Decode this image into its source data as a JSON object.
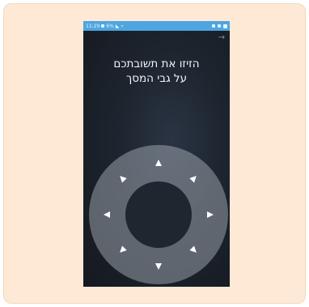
{
  "card": {
    "background": "#fde9d5",
    "border": "#f1d9bc"
  },
  "status_bar": {
    "time": "11:29",
    "battery": "6%",
    "background": "#4da6e0",
    "left_icons": [
      "battery-icon",
      "signal-icon",
      "wifi-icon"
    ],
    "right_icons": [
      "sync-icon",
      "storage-icon",
      "battery-status-icon"
    ]
  },
  "nav": {
    "next_icon": "arrow-right-icon",
    "glyph": "→"
  },
  "prompt": {
    "line1": "הזיזו את תשובתכם",
    "line2": "על גבי המסך"
  },
  "dial": {
    "directions": [
      "up",
      "up-right",
      "right",
      "down-right",
      "down",
      "down-left",
      "left",
      "up-left"
    ],
    "arrow_color": "#ffffff"
  }
}
